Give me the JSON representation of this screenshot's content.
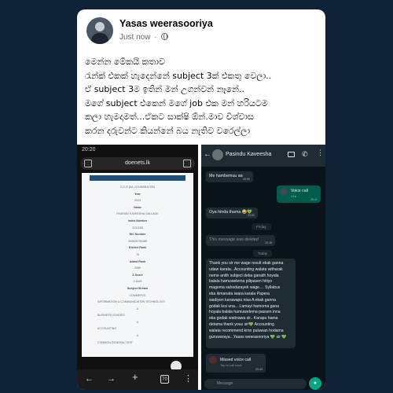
{
  "post": {
    "author": "Yasas weerasooriya",
    "time": "Just now",
    "text_lines": [
      "මෙන්න මේකයි කතාව",
      "රැන්ක් එකක් හැදෙන්නේ subject 3ක් එකතු වෙලා..",
      "ඒ subject 3ම ඉතින් මන් උගන්වන් නෑනේ..",
      "මගේ subject එකෙන් මගේ job එක මන් හරියටම",
      "කලා හැමදාමත්...ඒකට සාක්ෂි ඕන්.මාව විශ්වාස",
      "කරන දරුවන්ට කියන්නේ බය නැතිව වරෙල්ලා"
    ]
  },
  "browser": {
    "status_time": "20:20",
    "url": "doenets.lk",
    "doc_rows": [
      "G.C.E.(A/L) EXAMINATION",
      "Year",
      "2024",
      "Name",
      "PASINDU KAVEESHA GALLAGE",
      "Index Number",
      "3131168",
      "NIC Number",
      "200639700486",
      "District Rank",
      "76",
      "Island Rank",
      "2080",
      "Z-Score",
      "1.6445",
      "Subject Stream",
      "COMMERCE",
      "INFORMATION & COMMUNICATION TECHNOLOGY",
      "A",
      "BUSINESS STUDIES",
      "A",
      "ACCOUNTING",
      "A",
      "COMMON GENERAL TEST"
    ],
    "nav": {
      "back": "←",
      "forward": "→",
      "add": "+",
      "tabs": "70",
      "menu": "⋮"
    }
  },
  "chat": {
    "contact": "Pasindu Kaveesha",
    "messages": [
      {
        "text": "Me hambemuu aa",
        "time": "20:59"
      },
      {
        "title": "Voice call",
        "sub": "1 hr",
        "time": "20:41"
      },
      {
        "text": "Oya hinda thama 😂💚",
        "time": "22:52"
      },
      {
        "day": "Friday"
      },
      {
        "text": "This message was deleted",
        "time": "20:18"
      },
      {
        "day": "Today"
      },
      {
        "title": "Missed voice call",
        "sub": "Tap to call back",
        "time": "09:43"
      }
    ],
    "long_message": [
      "Thank you sir me wage result ekak ganna",
      "udaw karata...Accounting walata witharak",
      "neme anith subject deka ganath hoyala",
      "balala hamuwelema pilipasen hitiyo",
      "magema sahodarayek wage.... Syllabus",
      "eka ikmanata iwara karala Papera",
      "wadiyen karawapu nisa A ekak ganna",
      "godak lesi una... Lamayi hamoma gana",
      "hoyala balala hamuwelema passen inna",
      "eka godak watinawa sir.. Karapu hama",
      "detama thank youu sir💚 Accounting",
      "walata recommend krnn puluwan hodama",
      "guruwaraya...Yasas weerasooriya 💚 sir 💚"
    ],
    "input_placeholder": "Message"
  }
}
